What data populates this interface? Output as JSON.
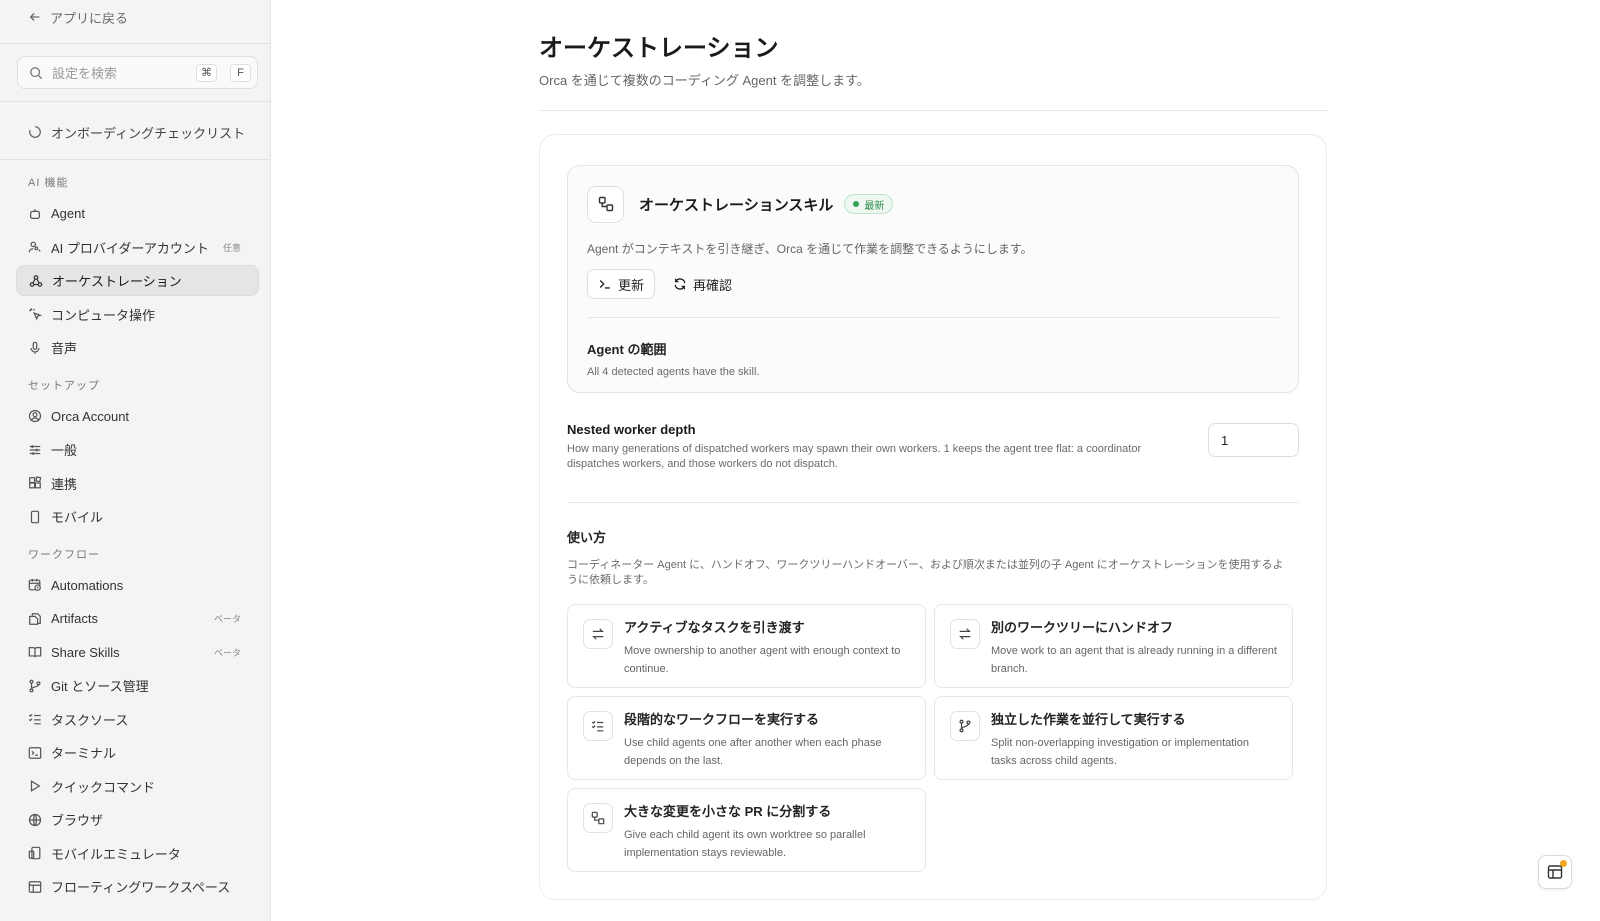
{
  "sidebar": {
    "back_label": "アプリに戻る",
    "search": {
      "placeholder": "設定を検索",
      "shortcut_key1": "⌘",
      "shortcut_key2": "F"
    },
    "onboarding_label": "オンボーディングチェックリスト",
    "sections": [
      {
        "label": "AI 機能",
        "items": [
          {
            "label": "Agent",
            "icon": "robot-icon",
            "tag": "",
            "active": false
          },
          {
            "label": "AI プロバイダーアカウント",
            "icon": "user-key-icon",
            "tag": "任意",
            "active": false
          },
          {
            "label": "オーケストレーション",
            "icon": "network-icon",
            "tag": "",
            "active": true
          },
          {
            "label": "コンピュータ操作",
            "icon": "pointer-click-icon",
            "tag": "",
            "active": false
          },
          {
            "label": "音声",
            "icon": "microphone-icon",
            "tag": "",
            "active": false
          }
        ]
      },
      {
        "label": "セットアップ",
        "items": [
          {
            "label": "Orca Account",
            "icon": "user-circle-icon",
            "tag": "",
            "active": false
          },
          {
            "label": "一般",
            "icon": "sliders-icon",
            "tag": "",
            "active": false
          },
          {
            "label": "連携",
            "icon": "blocks-icon",
            "tag": "",
            "active": false
          },
          {
            "label": "モバイル",
            "icon": "phone-icon",
            "tag": "",
            "active": false
          }
        ]
      },
      {
        "label": "ワークフロー",
        "items": [
          {
            "label": "Automations",
            "icon": "calendar-clock-icon",
            "tag": "",
            "active": false
          },
          {
            "label": "Artifacts",
            "icon": "files-icon",
            "tag": "ベータ",
            "active": false
          },
          {
            "label": "Share Skills",
            "icon": "book-icon",
            "tag": "ベータ",
            "active": false
          },
          {
            "label": "Git とソース管理",
            "icon": "git-branch-icon",
            "tag": "",
            "active": false
          },
          {
            "label": "タスクソース",
            "icon": "checklist-icon",
            "tag": "",
            "active": false
          },
          {
            "label": "ターミナル",
            "icon": "terminal-icon",
            "tag": "",
            "active": false
          },
          {
            "label": "クイックコマンド",
            "icon": "play-icon",
            "tag": "",
            "active": false
          },
          {
            "label": "ブラウザ",
            "icon": "globe-icon",
            "tag": "",
            "active": false
          },
          {
            "label": "モバイルエミュレータ",
            "icon": "devices-icon",
            "tag": "",
            "active": false
          },
          {
            "label": "フローティングワークスペース",
            "icon": "layout-icon",
            "tag": "",
            "active": false
          }
        ]
      }
    ]
  },
  "main": {
    "title": "オーケストレーション",
    "subtitle": "Orca を通じて複数のコーディング Agent を調整します。",
    "skill": {
      "title": "オーケストレーションスキル",
      "badge": "最新",
      "description": "Agent がコンテキストを引き継ぎ、Orca を通じて作業を調整できるようにします。",
      "update_label": "更新",
      "recheck_label": "再確認",
      "scope_title": "Agent の範囲",
      "scope_desc": "All 4 detected agents have the skill."
    },
    "depth": {
      "title": "Nested worker depth",
      "description": "How many generations of dispatched workers may spawn their own workers. 1 keeps the agent tree flat: a coordinator dispatches workers, and those workers do not dispatch.",
      "value": "1"
    },
    "usage": {
      "title": "使い方",
      "description": "コーディネーター Agent に、ハンドオフ、ワークツリーハンドオーバー、および順次または並列の子 Agent にオーケストレーションを使用するように依頼します。",
      "tiles": [
        {
          "title": "アクティブなタスクを引き渡す",
          "desc": "Move ownership to another agent with enough context to continue.",
          "icon": "swap-icon"
        },
        {
          "title": "別のワークツリーにハンドオフ",
          "desc": "Move work to an agent that is already running in a different branch.",
          "icon": "swap-icon"
        },
        {
          "title": "段階的なワークフローを実行する",
          "desc": "Use child agents one after another when each phase depends on the last.",
          "icon": "list-check-icon"
        },
        {
          "title": "独立した作業を並行して実行する",
          "desc": "Split non-overlapping investigation or implementation tasks across child agents.",
          "icon": "git-fork-icon"
        },
        {
          "title": "大きな変更を小さな PR に分割する",
          "desc": "Give each child agent its own worktree so parallel implementation stays reviewable.",
          "icon": "split-icon"
        }
      ]
    }
  },
  "colors": {
    "badge_green": "#2fa35a",
    "notification": "#f5a623",
    "active_bg": "#e5e5e5"
  }
}
